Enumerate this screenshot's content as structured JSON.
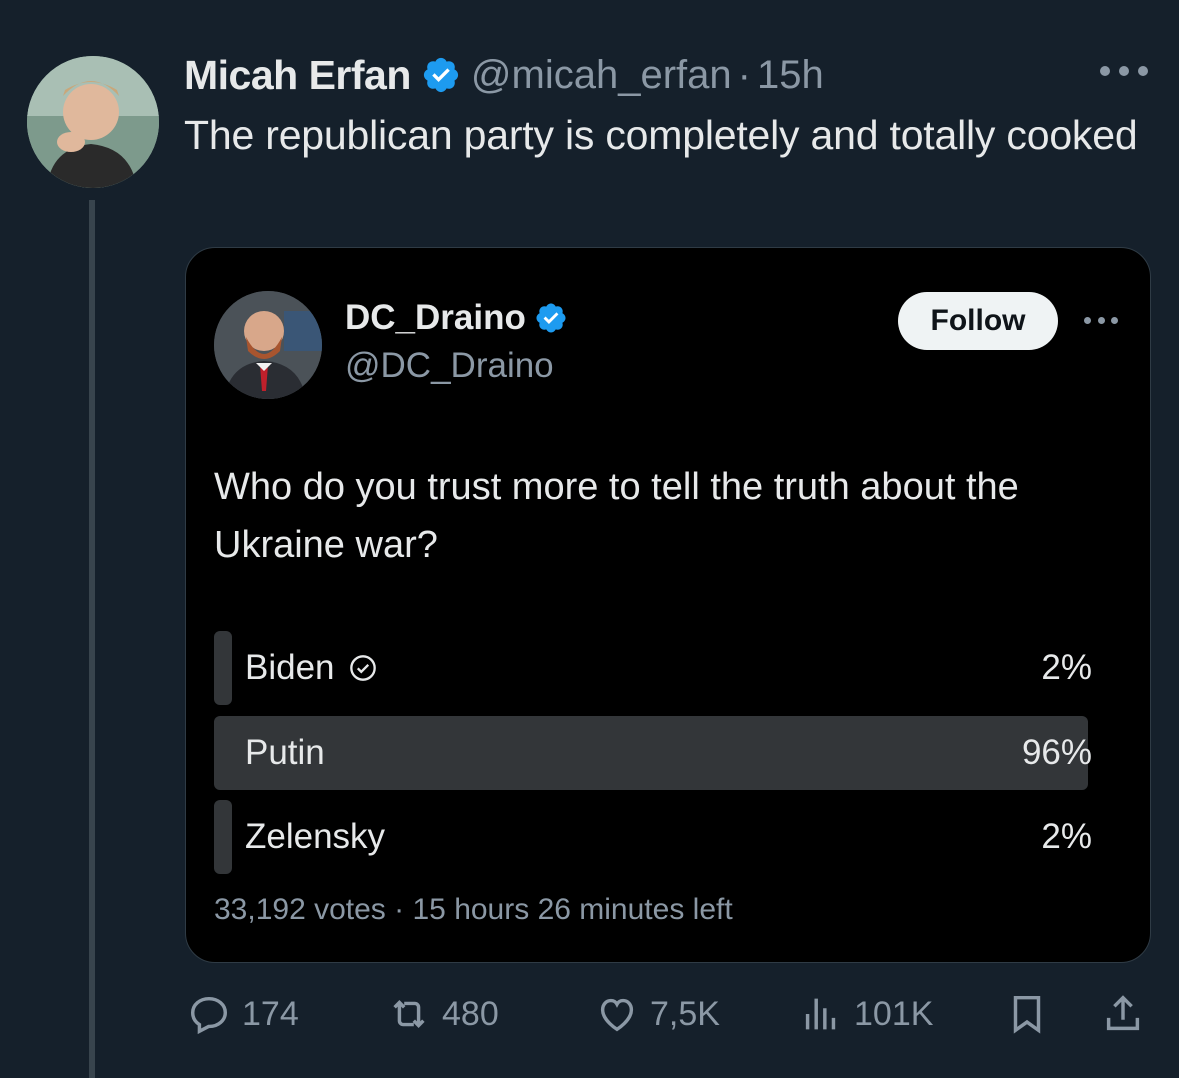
{
  "tweet": {
    "author_name": "Micah Erfan",
    "author_handle": "@micah_erfan",
    "separator": "·",
    "time": "15h",
    "text": "The republican party is completely and totally cooked"
  },
  "quoted_card": {
    "author_name": "DC_Draino",
    "author_handle": "@DC_Draino",
    "follow_label": "Follow",
    "question": "Who do you trust more to tell the truth about the Ukraine war?",
    "poll": {
      "options": [
        {
          "label": "Biden",
          "percent": "2%",
          "value": 0.02,
          "selected": true
        },
        {
          "label": "Putin",
          "percent": "96%",
          "value": 0.96,
          "selected": false
        },
        {
          "label": "Zelensky",
          "percent": "2%",
          "value": 0.02,
          "selected": false
        }
      ],
      "votes": "33,192 votes",
      "meta_separator": "·",
      "time_left": "15 hours 26 minutes left"
    }
  },
  "actions": {
    "replies": "174",
    "reposts": "480",
    "likes": "7,5K",
    "views": "101K"
  },
  "icons": {
    "verified": "verified-badge-icon",
    "reply": "reply-icon",
    "repost": "repost-icon",
    "like": "heart-icon",
    "views": "views-icon",
    "bookmark": "bookmark-icon",
    "share": "share-icon",
    "more": "more-icon"
  },
  "colors": {
    "background": "#15202b",
    "verified_blue": "#1d9bf0",
    "secondary_text": "#8b98a5",
    "poll_bar": "#333639"
  }
}
